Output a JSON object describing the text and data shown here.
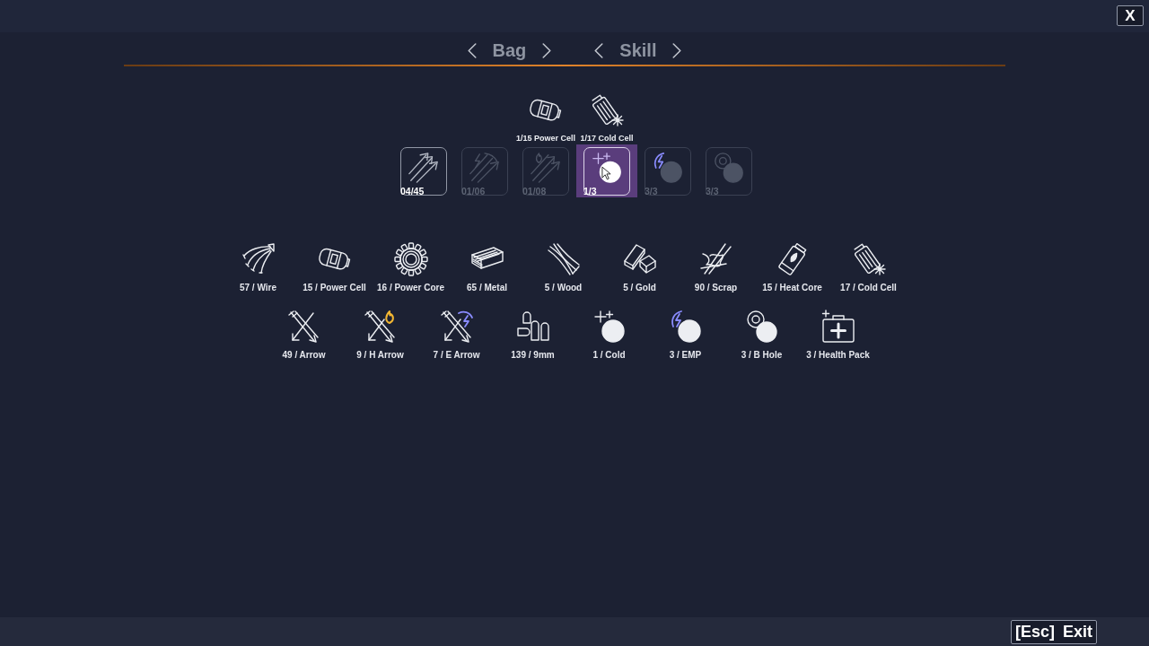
{
  "close_button": {
    "label": "X"
  },
  "pickers": [
    {
      "label": "Bag"
    },
    {
      "label": "Skill"
    }
  ],
  "requirements": [
    {
      "label": "1/15 Power Cell"
    },
    {
      "label": "1/17 Cold Cell"
    }
  ],
  "skill_slots": [
    {
      "count": "04/45",
      "selected": false,
      "dimmed": false
    },
    {
      "count": "01/06",
      "selected": false,
      "dimmed": true
    },
    {
      "count": "01/08",
      "selected": false,
      "dimmed": true
    },
    {
      "count": "1/3",
      "selected": true,
      "dimmed": false
    },
    {
      "count": "3/3",
      "selected": false,
      "dimmed": true
    },
    {
      "count": "3/3",
      "selected": false,
      "dimmed": true
    }
  ],
  "inventory_rows": [
    [
      {
        "label": "57 / Wire"
      },
      {
        "label": "15 / Power Cell"
      },
      {
        "label": "16 / Power Core"
      },
      {
        "label": "65 / Metal"
      },
      {
        "label": "5 / Wood"
      },
      {
        "label": "5 / Gold"
      },
      {
        "label": "90 / Scrap"
      },
      {
        "label": "15 / Heat Core"
      },
      {
        "label": "17 / Cold Cell"
      }
    ],
    [
      {
        "label": "49 / Arrow"
      },
      {
        "label": "9 / H Arrow"
      },
      {
        "label": "7 / E Arrow"
      },
      {
        "label": "139 / 9mm"
      },
      {
        "label": "1 / Cold"
      },
      {
        "label": "3 / EMP"
      },
      {
        "label": "3 / B Hole"
      },
      {
        "label": "3 / Health Pack"
      }
    ]
  ],
  "exit_button": {
    "key": "[Esc]",
    "label": "Exit"
  }
}
